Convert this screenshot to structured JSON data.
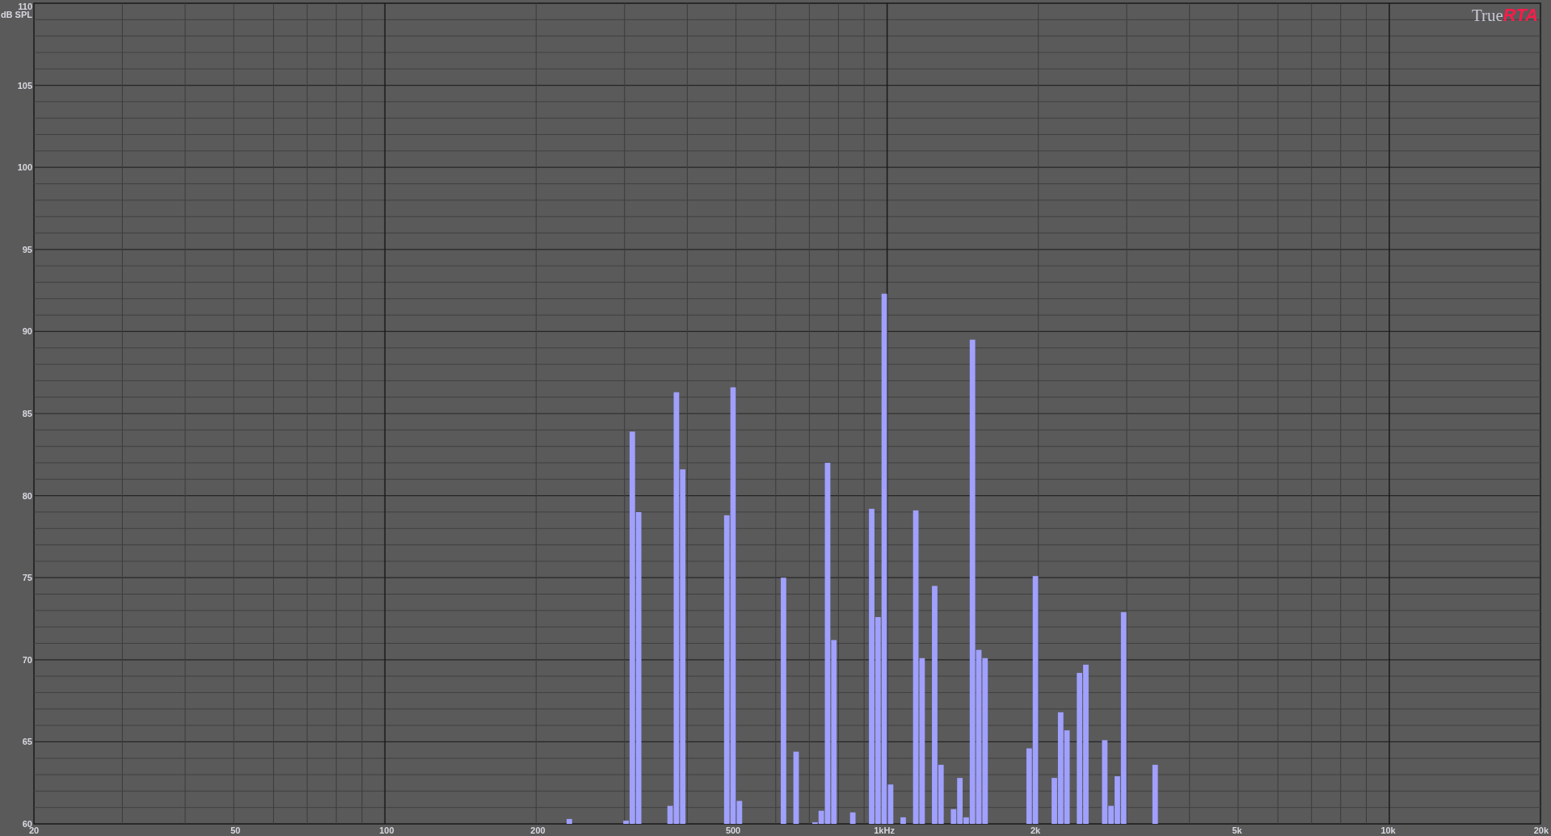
{
  "logo": {
    "text": "True",
    "accent": "RTA"
  },
  "chart_data": {
    "type": "bar",
    "ylabel": "dB SPL",
    "ylim": [
      60,
      110
    ],
    "grid": true,
    "yticks": [
      60,
      65,
      70,
      75,
      80,
      85,
      90,
      95,
      100,
      105,
      110
    ],
    "categories": [
      "20",
      null,
      null,
      null,
      null,
      null,
      null,
      null,
      null,
      null,
      null,
      null,
      null,
      null,
      null,
      null,
      null,
      null,
      null,
      null,
      null,
      null,
      null,
      null,
      null,
      null,
      null,
      null,
      null,
      null,
      null,
      null,
      "50",
      null,
      null,
      null,
      null,
      null,
      null,
      null,
      null,
      null,
      null,
      null,
      null,
      null,
      null,
      null,
      null,
      null,
      null,
      null,
      null,
      null,
      null,
      null,
      "100",
      null,
      null,
      null,
      null,
      null,
      null,
      null,
      null,
      null,
      null,
      null,
      null,
      null,
      null,
      null,
      null,
      null,
      null,
      null,
      null,
      null,
      null,
      null,
      "200",
      null,
      null,
      null,
      null,
      null,
      null,
      null,
      null,
      null,
      null,
      null,
      null,
      null,
      null,
      null,
      null,
      null,
      null,
      null,
      null,
      null,
      null,
      null,
      null,
      null,
      null,
      null,
      null,
      null,
      null,
      "500",
      null,
      null,
      null,
      null,
      null,
      null,
      null,
      null,
      null,
      null,
      null,
      null,
      null,
      null,
      null,
      null,
      null,
      null,
      null,
      null,
      null,
      null,
      null,
      "1kHz",
      null,
      null,
      null,
      null,
      null,
      null,
      null,
      null,
      null,
      null,
      null,
      null,
      null,
      null,
      null,
      null,
      null,
      null,
      null,
      null,
      null,
      null,
      null,
      "2k",
      null,
      null,
      null,
      null,
      null,
      null,
      null,
      null,
      null,
      null,
      null,
      null,
      null,
      null,
      null,
      null,
      null,
      null,
      null,
      null,
      null,
      null,
      null,
      null,
      null,
      null,
      null,
      null,
      null,
      null,
      null,
      "5k",
      null,
      null,
      null,
      null,
      null,
      null,
      null,
      null,
      null,
      null,
      null,
      null,
      null,
      null,
      null,
      null,
      null,
      null,
      null,
      null,
      null,
      null,
      null,
      "10k",
      null,
      null,
      null,
      null,
      null,
      null,
      null,
      null,
      null,
      null,
      null,
      null,
      null,
      null,
      null,
      null,
      null,
      null,
      null,
      null,
      null,
      null,
      null,
      "20k"
    ],
    "series": [
      {
        "color": "#a0a0ff",
        "values": [
          null,
          null,
          null,
          null,
          null,
          null,
          null,
          null,
          null,
          null,
          null,
          null,
          null,
          null,
          null,
          null,
          null,
          null,
          null,
          null,
          null,
          null,
          null,
          null,
          null,
          null,
          null,
          null,
          null,
          null,
          null,
          null,
          null,
          null,
          null,
          null,
          null,
          null,
          null,
          null,
          null,
          null,
          null,
          null,
          null,
          null,
          null,
          null,
          null,
          null,
          null,
          null,
          null,
          null,
          null,
          null,
          null,
          null,
          null,
          null,
          null,
          null,
          null,
          null,
          null,
          null,
          null,
          null,
          null,
          null,
          null,
          null,
          null,
          null,
          null,
          null,
          null,
          null,
          null,
          null,
          null,
          null,
          null,
          null,
          null,
          60.3,
          null,
          null,
          null,
          null,
          null,
          null,
          null,
          null,
          60.2,
          83.9,
          79.0,
          null,
          null,
          null,
          null,
          61.1,
          86.3,
          81.6,
          null,
          null,
          null,
          null,
          null,
          null,
          78.8,
          86.6,
          61.4,
          null,
          null,
          null,
          null,
          null,
          null,
          75.0,
          null,
          64.4,
          null,
          null,
          60.1,
          60.8,
          82.0,
          71.2,
          null,
          null,
          60.7,
          null,
          null,
          79.2,
          72.6,
          92.3,
          62.4,
          null,
          60.4,
          null,
          79.1,
          70.1,
          null,
          74.5,
          63.6,
          null,
          60.9,
          62.8,
          60.4,
          89.5,
          70.6,
          70.1,
          null,
          null,
          null,
          null,
          null,
          null,
          64.6,
          75.1,
          null,
          null,
          62.8,
          66.8,
          65.7,
          null,
          69.2,
          69.7,
          null,
          null,
          65.1,
          61.1,
          62.9,
          72.9,
          null,
          null,
          null,
          null,
          63.6,
          null,
          null,
          null,
          null,
          null,
          null,
          null,
          null,
          null,
          null,
          null,
          null,
          null,
          null,
          null,
          null,
          null,
          null,
          null,
          null,
          null,
          null,
          null,
          null,
          null,
          null,
          null,
          null,
          null,
          null,
          null,
          null,
          null,
          null,
          null,
          null,
          null,
          null,
          null,
          null,
          null,
          null,
          null,
          null,
          null,
          null,
          null,
          null,
          null,
          null,
          null,
          null,
          null,
          null,
          null,
          null,
          null,
          null,
          null,
          null,
          null
        ]
      }
    ]
  }
}
